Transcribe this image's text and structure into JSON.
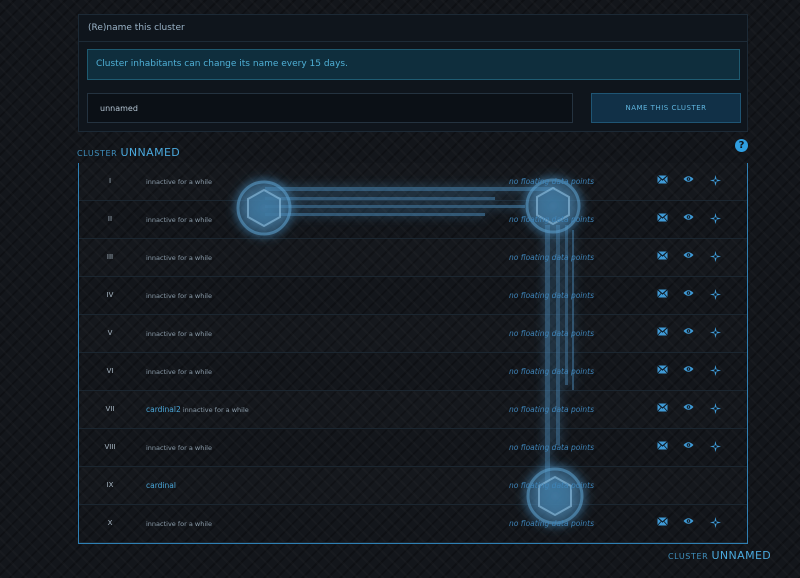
{
  "rename_panel": {
    "title": "(Re)name this cluster",
    "notice": "Cluster inhabitants can change its name every 15 days.",
    "input_value": "unnamed",
    "button_label": "NAME THIS CLUSTER"
  },
  "cluster": {
    "prefix": "CLUSTER",
    "name": "UNNAMED"
  },
  "help_glyph": "?",
  "rows": [
    {
      "num": "I",
      "owner": "",
      "status": "innactive for a while",
      "floating": "no floating data points",
      "actions": true
    },
    {
      "num": "II",
      "owner": "",
      "status": "innactive for a while",
      "floating": "no floating data points",
      "actions": true
    },
    {
      "num": "III",
      "owner": "",
      "status": "innactive for a while",
      "floating": "no floating data points",
      "actions": true
    },
    {
      "num": "IV",
      "owner": "",
      "status": "innactive for a while",
      "floating": "no floating data points",
      "actions": true
    },
    {
      "num": "V",
      "owner": "",
      "status": "innactive for a while",
      "floating": "no floating data points",
      "actions": true
    },
    {
      "num": "VI",
      "owner": "",
      "status": "innactive for a while",
      "floating": "no floating data points",
      "actions": true
    },
    {
      "num": "VII",
      "owner": "cardinal2",
      "status": "innactive for a while",
      "floating": "no floating data points",
      "actions": true
    },
    {
      "num": "VIII",
      "owner": "",
      "status": "innactive for a while",
      "floating": "no floating data points",
      "actions": true
    },
    {
      "num": "IX",
      "owner": "cardinal",
      "status": "",
      "floating": "no floating data points",
      "actions": false
    },
    {
      "num": "X",
      "owner": "",
      "status": "innactive for a while",
      "floating": "no floating data points",
      "actions": true
    }
  ],
  "icons": {
    "message": "envelope-icon",
    "view": "eye-icon",
    "move": "target-icon",
    "help": "question-icon"
  },
  "colors": {
    "accent": "#3f9ad6",
    "notice_bg": "#0f2e3d",
    "table_border": "#2f7fb3",
    "glow": "#4a8fbf"
  }
}
